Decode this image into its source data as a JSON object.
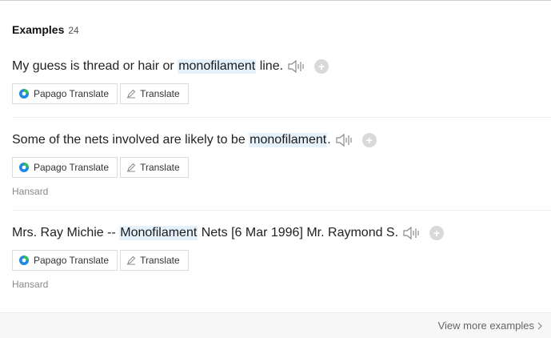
{
  "header": {
    "title": "Examples",
    "count": "24"
  },
  "examples": [
    {
      "before": "My guess is thread or hair or ",
      "highlight": "monofilament",
      "after": " line.",
      "papago_label": "Papago Translate",
      "translate_label": "Translate",
      "source": ""
    },
    {
      "before": "Some of the nets involved are likely to be ",
      "highlight": "monofilament",
      "after": ".",
      "papago_label": "Papago Translate",
      "translate_label": "Translate",
      "source": "Hansard"
    },
    {
      "before": "Mrs. Ray Michie -- ",
      "highlight": "Monofilament",
      "after": " Nets [6 Mar 1996] Mr. Raymond S.",
      "papago_label": "Papago Translate",
      "translate_label": "Translate",
      "source": "Hansard"
    }
  ],
  "footer": {
    "more_label": "View more examples"
  },
  "icons": {
    "speaker": "speaker-icon",
    "add": "add-icon",
    "papago": "papago-logo-icon",
    "pencil": "pencil-icon",
    "chevron": "chevron-right-icon"
  },
  "colors": {
    "highlight": "#e5f1fb",
    "papago_green": "#2dbe60",
    "papago_blue": "#1e88e5"
  }
}
